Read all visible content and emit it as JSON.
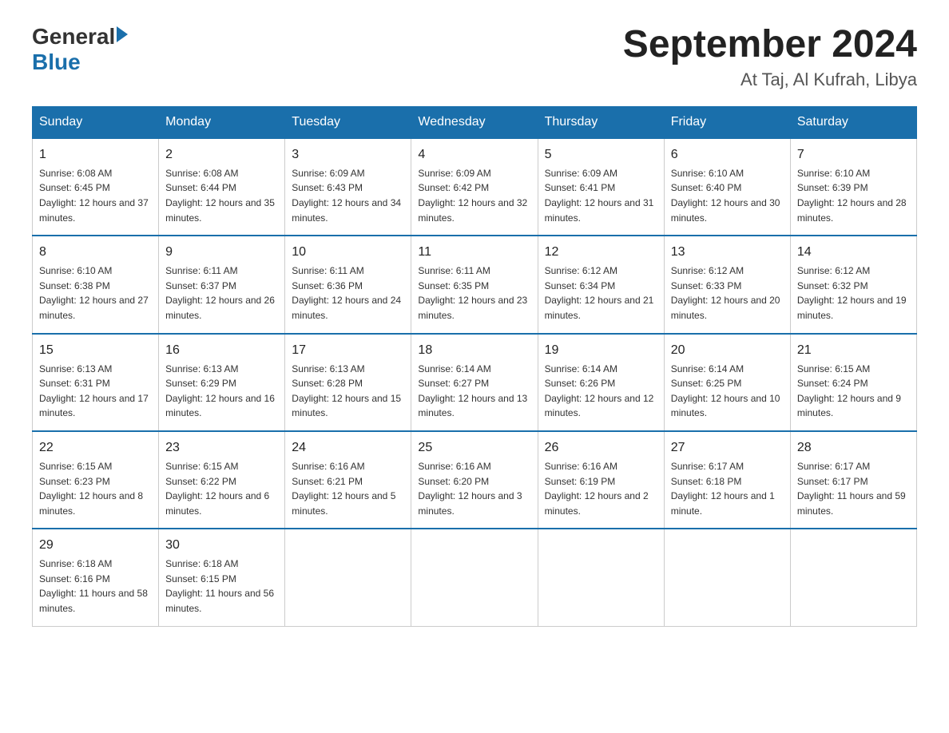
{
  "logo": {
    "general": "General",
    "blue": "Blue"
  },
  "title": "September 2024",
  "subtitle": "At Taj, Al Kufrah, Libya",
  "days_of_week": [
    "Sunday",
    "Monday",
    "Tuesday",
    "Wednesday",
    "Thursday",
    "Friday",
    "Saturday"
  ],
  "weeks": [
    [
      {
        "day": "1",
        "sunrise": "Sunrise: 6:08 AM",
        "sunset": "Sunset: 6:45 PM",
        "daylight": "Daylight: 12 hours and 37 minutes."
      },
      {
        "day": "2",
        "sunrise": "Sunrise: 6:08 AM",
        "sunset": "Sunset: 6:44 PM",
        "daylight": "Daylight: 12 hours and 35 minutes."
      },
      {
        "day": "3",
        "sunrise": "Sunrise: 6:09 AM",
        "sunset": "Sunset: 6:43 PM",
        "daylight": "Daylight: 12 hours and 34 minutes."
      },
      {
        "day": "4",
        "sunrise": "Sunrise: 6:09 AM",
        "sunset": "Sunset: 6:42 PM",
        "daylight": "Daylight: 12 hours and 32 minutes."
      },
      {
        "day": "5",
        "sunrise": "Sunrise: 6:09 AM",
        "sunset": "Sunset: 6:41 PM",
        "daylight": "Daylight: 12 hours and 31 minutes."
      },
      {
        "day": "6",
        "sunrise": "Sunrise: 6:10 AM",
        "sunset": "Sunset: 6:40 PM",
        "daylight": "Daylight: 12 hours and 30 minutes."
      },
      {
        "day": "7",
        "sunrise": "Sunrise: 6:10 AM",
        "sunset": "Sunset: 6:39 PM",
        "daylight": "Daylight: 12 hours and 28 minutes."
      }
    ],
    [
      {
        "day": "8",
        "sunrise": "Sunrise: 6:10 AM",
        "sunset": "Sunset: 6:38 PM",
        "daylight": "Daylight: 12 hours and 27 minutes."
      },
      {
        "day": "9",
        "sunrise": "Sunrise: 6:11 AM",
        "sunset": "Sunset: 6:37 PM",
        "daylight": "Daylight: 12 hours and 26 minutes."
      },
      {
        "day": "10",
        "sunrise": "Sunrise: 6:11 AM",
        "sunset": "Sunset: 6:36 PM",
        "daylight": "Daylight: 12 hours and 24 minutes."
      },
      {
        "day": "11",
        "sunrise": "Sunrise: 6:11 AM",
        "sunset": "Sunset: 6:35 PM",
        "daylight": "Daylight: 12 hours and 23 minutes."
      },
      {
        "day": "12",
        "sunrise": "Sunrise: 6:12 AM",
        "sunset": "Sunset: 6:34 PM",
        "daylight": "Daylight: 12 hours and 21 minutes."
      },
      {
        "day": "13",
        "sunrise": "Sunrise: 6:12 AM",
        "sunset": "Sunset: 6:33 PM",
        "daylight": "Daylight: 12 hours and 20 minutes."
      },
      {
        "day": "14",
        "sunrise": "Sunrise: 6:12 AM",
        "sunset": "Sunset: 6:32 PM",
        "daylight": "Daylight: 12 hours and 19 minutes."
      }
    ],
    [
      {
        "day": "15",
        "sunrise": "Sunrise: 6:13 AM",
        "sunset": "Sunset: 6:31 PM",
        "daylight": "Daylight: 12 hours and 17 minutes."
      },
      {
        "day": "16",
        "sunrise": "Sunrise: 6:13 AM",
        "sunset": "Sunset: 6:29 PM",
        "daylight": "Daylight: 12 hours and 16 minutes."
      },
      {
        "day": "17",
        "sunrise": "Sunrise: 6:13 AM",
        "sunset": "Sunset: 6:28 PM",
        "daylight": "Daylight: 12 hours and 15 minutes."
      },
      {
        "day": "18",
        "sunrise": "Sunrise: 6:14 AM",
        "sunset": "Sunset: 6:27 PM",
        "daylight": "Daylight: 12 hours and 13 minutes."
      },
      {
        "day": "19",
        "sunrise": "Sunrise: 6:14 AM",
        "sunset": "Sunset: 6:26 PM",
        "daylight": "Daylight: 12 hours and 12 minutes."
      },
      {
        "day": "20",
        "sunrise": "Sunrise: 6:14 AM",
        "sunset": "Sunset: 6:25 PM",
        "daylight": "Daylight: 12 hours and 10 minutes."
      },
      {
        "day": "21",
        "sunrise": "Sunrise: 6:15 AM",
        "sunset": "Sunset: 6:24 PM",
        "daylight": "Daylight: 12 hours and 9 minutes."
      }
    ],
    [
      {
        "day": "22",
        "sunrise": "Sunrise: 6:15 AM",
        "sunset": "Sunset: 6:23 PM",
        "daylight": "Daylight: 12 hours and 8 minutes."
      },
      {
        "day": "23",
        "sunrise": "Sunrise: 6:15 AM",
        "sunset": "Sunset: 6:22 PM",
        "daylight": "Daylight: 12 hours and 6 minutes."
      },
      {
        "day": "24",
        "sunrise": "Sunrise: 6:16 AM",
        "sunset": "Sunset: 6:21 PM",
        "daylight": "Daylight: 12 hours and 5 minutes."
      },
      {
        "day": "25",
        "sunrise": "Sunrise: 6:16 AM",
        "sunset": "Sunset: 6:20 PM",
        "daylight": "Daylight: 12 hours and 3 minutes."
      },
      {
        "day": "26",
        "sunrise": "Sunrise: 6:16 AM",
        "sunset": "Sunset: 6:19 PM",
        "daylight": "Daylight: 12 hours and 2 minutes."
      },
      {
        "day": "27",
        "sunrise": "Sunrise: 6:17 AM",
        "sunset": "Sunset: 6:18 PM",
        "daylight": "Daylight: 12 hours and 1 minute."
      },
      {
        "day": "28",
        "sunrise": "Sunrise: 6:17 AM",
        "sunset": "Sunset: 6:17 PM",
        "daylight": "Daylight: 11 hours and 59 minutes."
      }
    ],
    [
      {
        "day": "29",
        "sunrise": "Sunrise: 6:18 AM",
        "sunset": "Sunset: 6:16 PM",
        "daylight": "Daylight: 11 hours and 58 minutes."
      },
      {
        "day": "30",
        "sunrise": "Sunrise: 6:18 AM",
        "sunset": "Sunset: 6:15 PM",
        "daylight": "Daylight: 11 hours and 56 minutes."
      },
      null,
      null,
      null,
      null,
      null
    ]
  ]
}
